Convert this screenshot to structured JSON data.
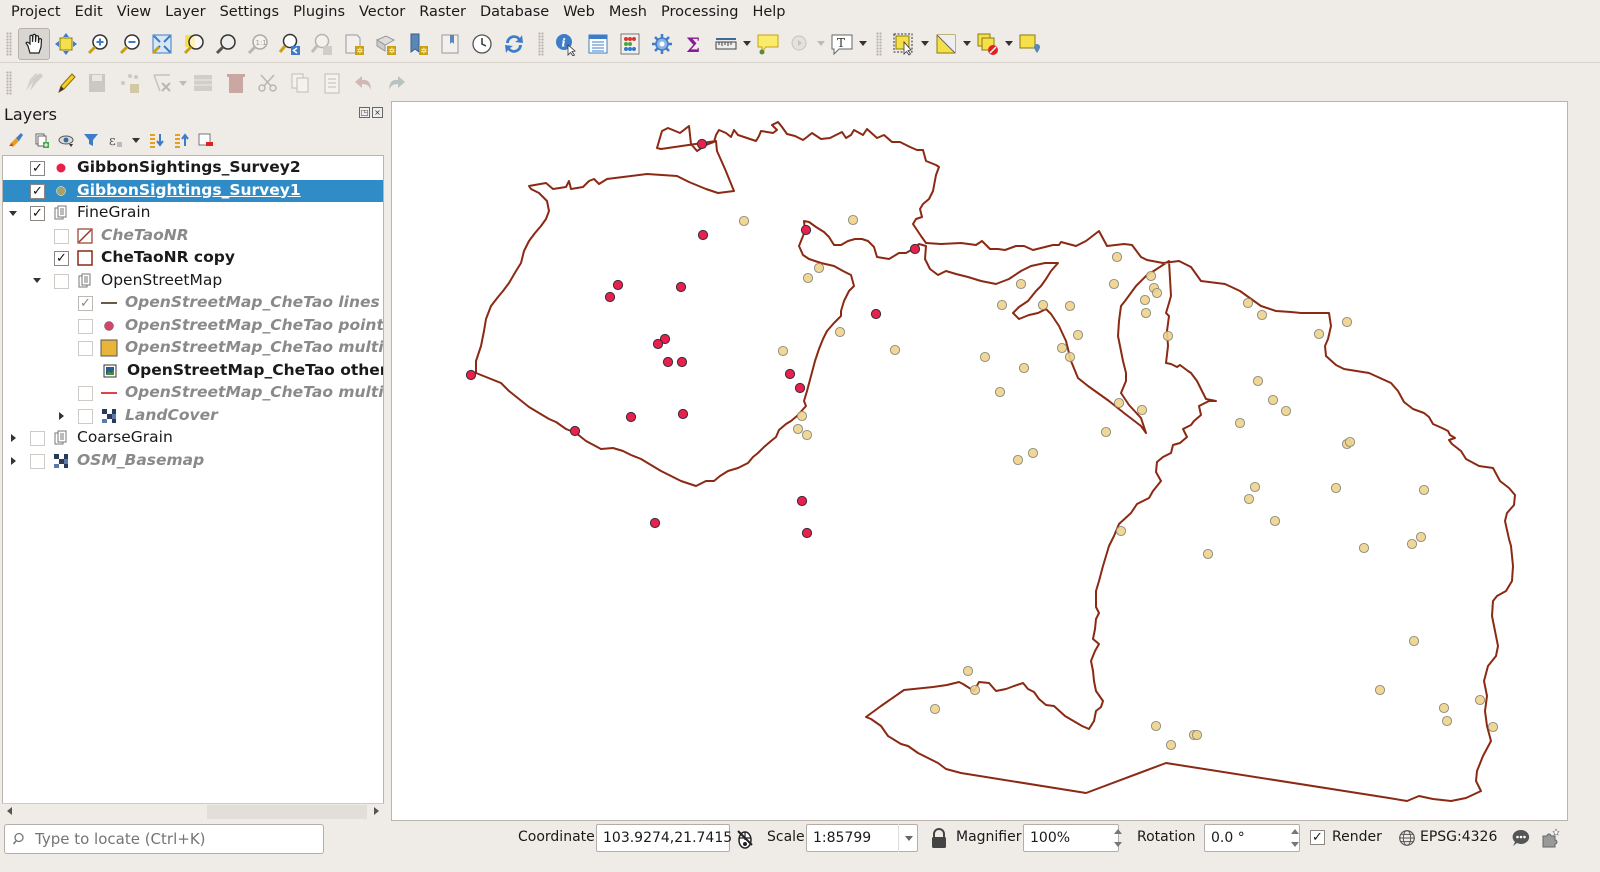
{
  "menubar": {
    "items": [
      "Project",
      "Edit",
      "View",
      "Layer",
      "Settings",
      "Plugins",
      "Vector",
      "Raster",
      "Database",
      "Web",
      "Mesh",
      "Processing",
      "Help"
    ]
  },
  "toolbar_map_nav": {
    "buttons": [
      {
        "icon": "pan-hand-icon",
        "active": true
      },
      {
        "icon": "pan-to-selection-icon"
      },
      {
        "icon": "zoom-in-icon"
      },
      {
        "icon": "zoom-out-icon"
      },
      {
        "icon": "zoom-full-icon"
      },
      {
        "icon": "zoom-to-selection-icon"
      },
      {
        "icon": "zoom-to-layer-icon"
      },
      {
        "icon": "zoom-native-resolution-icon",
        "disabled": true
      },
      {
        "icon": "zoom-last-icon"
      },
      {
        "icon": "zoom-next-icon",
        "disabled": true
      },
      {
        "icon": "new-map-view-icon"
      },
      {
        "icon": "new-3d-map-view-icon"
      },
      {
        "icon": "new-spatial-bookmark-icon"
      },
      {
        "icon": "show-spatial-bookmarks-icon"
      },
      {
        "icon": "temporal-controller-icon"
      },
      {
        "icon": "refresh-icon"
      }
    ]
  },
  "toolbar_attributes": {
    "buttons": [
      {
        "icon": "identify-features-icon"
      },
      {
        "icon": "open-attribute-table-icon"
      },
      {
        "icon": "field-calculator-icon"
      },
      {
        "icon": "processing-toolbox-icon"
      },
      {
        "icon": "statistical-summary-icon"
      },
      {
        "icon": "measure-line-icon",
        "dropdown": true
      },
      {
        "icon": "map-tips-icon"
      },
      {
        "icon": "actions-icon",
        "dropdown": true,
        "disabled": true
      },
      {
        "icon": "text-annotation-icon",
        "dropdown": true
      }
    ]
  },
  "toolbar_selection": {
    "buttons": [
      {
        "icon": "select-features-icon",
        "dropdown": true
      },
      {
        "icon": "select-by-expression-icon",
        "dropdown": true
      },
      {
        "icon": "deselect-features-icon",
        "dropdown": true
      },
      {
        "icon": "select-by-location-icon"
      }
    ]
  },
  "toolbar_digitizing": {
    "buttons": [
      {
        "icon": "current-edits-icon",
        "disabled": true,
        "dropdown": true
      },
      {
        "icon": "toggle-editing-icon"
      },
      {
        "icon": "save-layer-edits-icon",
        "disabled": true
      },
      {
        "icon": "add-point-feature-icon",
        "disabled": true
      },
      {
        "icon": "vertex-tool-icon",
        "disabled": true,
        "dropdown": true
      },
      {
        "icon": "modify-attributes-icon",
        "disabled": true
      },
      {
        "icon": "delete-selected-icon",
        "disabled": true
      },
      {
        "icon": "cut-features-icon",
        "disabled": true
      },
      {
        "icon": "copy-features-icon",
        "disabled": true
      },
      {
        "icon": "paste-features-icon",
        "disabled": true
      },
      {
        "icon": "undo-icon",
        "disabled": true
      },
      {
        "icon": "redo-icon",
        "disabled": true
      }
    ]
  },
  "layers_panel": {
    "title": "Layers",
    "float_button": "◳",
    "close_button": "×",
    "tools": [
      "style-manager-icon",
      "add-group-icon",
      "manage-visibility-icon",
      "filter-legend-icon",
      "filter-by-expression-icon",
      "expand-all-icon",
      "collapse-all-icon",
      "remove-layer-icon"
    ],
    "layers": [
      {
        "name": "GibbonSightings_Survey2",
        "checked": true,
        "style": "bold",
        "symbol": "point-red",
        "level": 0,
        "expander": "none"
      },
      {
        "name": "GibbonSightings_Survey1",
        "checked": true,
        "style": "bold",
        "symbol": "point-olive",
        "level": 0,
        "expander": "none",
        "selected": true
      },
      {
        "name": "FineGrain",
        "checked": true,
        "style": "normal",
        "symbol": "group",
        "level": 0,
        "expander": "down"
      },
      {
        "name": "CheTaoNR",
        "checked": false,
        "style": "italic",
        "symbol": "polygon-hatched",
        "level": 1,
        "expander": "none"
      },
      {
        "name": "CheTaoNR copy",
        "checked": true,
        "style": "bold",
        "symbol": "polygon-outline",
        "level": 1,
        "expander": "none"
      },
      {
        "name": "OpenStreetMap",
        "checked": false,
        "style": "normal",
        "symbol": "group",
        "level": 1,
        "expander": "down"
      },
      {
        "name": "OpenStreetMap_CheTao lines",
        "checked": true,
        "greyed": true,
        "style": "italic",
        "symbol": "line-brown",
        "level": 2,
        "expander": "none"
      },
      {
        "name": "OpenStreetMap_CheTao points",
        "checked": false,
        "style": "italic",
        "symbol": "point-pink",
        "level": 2,
        "expander": "none"
      },
      {
        "name": "OpenStreetMap_CheTao multipolygons",
        "checked": false,
        "style": "italic",
        "symbol": "polygon-yellow",
        "level": 2,
        "expander": "none"
      },
      {
        "name": "OpenStreetMap_CheTao other_relations",
        "checked": null,
        "style": "bold",
        "symbol": "raster-image",
        "level": 2,
        "expander": "none"
      },
      {
        "name": "OpenStreetMap_CheTao multilinestrings",
        "checked": false,
        "style": "italic",
        "symbol": "line-red",
        "level": 2,
        "expander": "none"
      },
      {
        "name": "LandCover",
        "checked": false,
        "style": "italic",
        "symbol": "raster-grid",
        "level": 2,
        "expander": "right"
      },
      {
        "name": "CoarseGrain",
        "checked": false,
        "style": "normal",
        "symbol": "group",
        "level": 0,
        "expander": "right"
      },
      {
        "name": "OSM_Basemap",
        "checked": false,
        "style": "italic",
        "symbol": "raster-grid",
        "level": 0,
        "expander": "right"
      }
    ]
  },
  "map": {
    "background": "#ffffff",
    "boundary_color": "#8b2a14",
    "survey2_color": "#e8214c",
    "survey1_color": "#f0d38c",
    "marker_stroke": "#555555"
  },
  "statusbar": {
    "locator_placeholder": "Type to locate (Ctrl+K)",
    "coordinate_label": "Coordinate",
    "coordinate_value": "103.9274,21.7415",
    "scale_label": "Scale",
    "scale_value": "1:85799",
    "magnifier_label": "Magnifier",
    "magnifier_value": "100%",
    "rotation_label": "Rotation",
    "rotation_value": "0.0 °",
    "render_label": "Render",
    "render_checked": "✓",
    "crs_label": "EPSG:4326"
  }
}
